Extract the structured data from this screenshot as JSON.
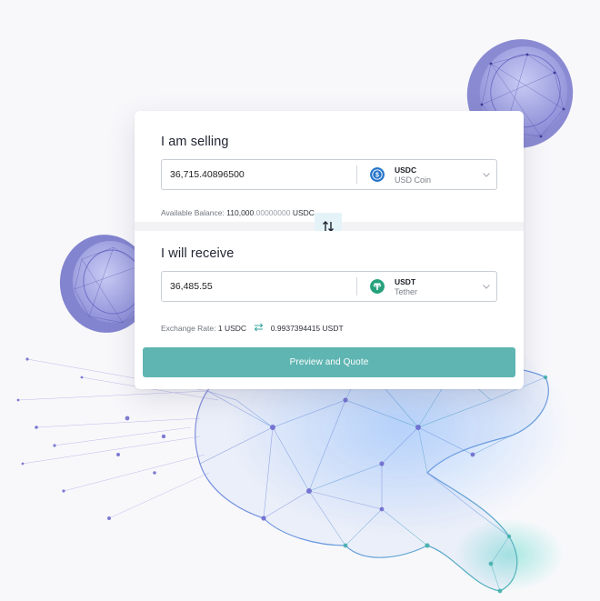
{
  "sell": {
    "heading": "I am selling",
    "amount": "36,715.40896500",
    "token": {
      "symbol": "USDC",
      "name": "USD Coin",
      "icon": "usdc-coin-icon",
      "color": "#2775ca"
    },
    "balance_label": "Available Balance:",
    "balance_int": "110,000",
    "balance_frac": ".00000000",
    "balance_unit": "USDC"
  },
  "receive": {
    "heading": "I will receive",
    "amount": "36,485.55",
    "token": {
      "symbol": "USDT",
      "name": "Tether",
      "icon": "tether-icon",
      "color": "#26a17b"
    },
    "rate_label": "Exchange Rate:",
    "rate_from": "1 USDC",
    "rate_to": "0.9937394415 USDT"
  },
  "swap_icon": "swap-arrows-icon",
  "cta_label": "Preview and Quote",
  "colors": {
    "accent": "#5fb5b2",
    "swap_bg": "#e4f3f8",
    "coin_purple": "#9b9ee0"
  }
}
